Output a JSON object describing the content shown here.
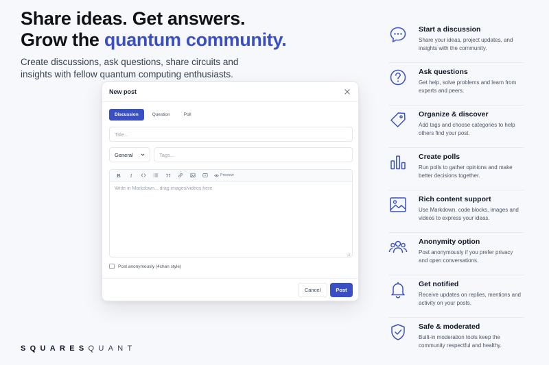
{
  "hero": {
    "line1": "Share ideas. Get answers.",
    "line2_prefix": "Grow the ",
    "line2_accent": "quantum community.",
    "subtitle": "Create discussions, ask questions, share circuits and insights with fellow quantum computing enthusiasts."
  },
  "modal": {
    "title": "New post",
    "tabs": [
      {
        "label": "Discussion",
        "active": true
      },
      {
        "label": "Question",
        "active": false
      },
      {
        "label": "Poll",
        "active": false
      }
    ],
    "title_placeholder": "Title...",
    "category": "General",
    "tags_placeholder": "Tags...",
    "toolbar": {
      "bold": "B",
      "italic": "I",
      "preview": "Preview",
      "icons": [
        "code-icon",
        "list-icon",
        "quote-icon",
        "link-icon",
        "image-icon",
        "video-icon",
        "eye-icon"
      ]
    },
    "editor_placeholder": "Write in Markdown... drag images/videos here",
    "anonymous_label": "Post anonymously (4chan style)",
    "cancel_label": "Cancel",
    "post_label": "Post"
  },
  "brand": {
    "part1": "SQUARES",
    "part2": "QUANT"
  },
  "features": [
    {
      "icon": "chat-icon",
      "title": "Start a discussion",
      "desc": "Share your ideas, project updates, and insights with the community."
    },
    {
      "icon": "question-icon",
      "title": "Ask questions",
      "desc": "Get help, solve problems and learn from experts and peers."
    },
    {
      "icon": "tag-icon",
      "title": "Organize & discover",
      "desc": "Add tags and choose categories to help others find your post."
    },
    {
      "icon": "bar-chart-icon",
      "title": "Create polls",
      "desc": "Run polls to gather opinions and make better decisions together."
    },
    {
      "icon": "image-icon",
      "title": "Rich content support",
      "desc": "Use Markdown, code blocks, images and videos to express your ideas."
    },
    {
      "icon": "users-icon",
      "title": "Anonymity option",
      "desc": "Post anonymously if you prefer privacy and open conversations."
    },
    {
      "icon": "bell-icon",
      "title": "Get notified",
      "desc": "Receive updates on replies, mentions and activity on your posts."
    },
    {
      "icon": "shield-icon",
      "title": "Safe & moderated",
      "desc": "Built-in moderation tools keep the community respectful and healthy."
    }
  ],
  "colors": {
    "accent": "#3b4fc4",
    "background": "#f7f8fb"
  }
}
